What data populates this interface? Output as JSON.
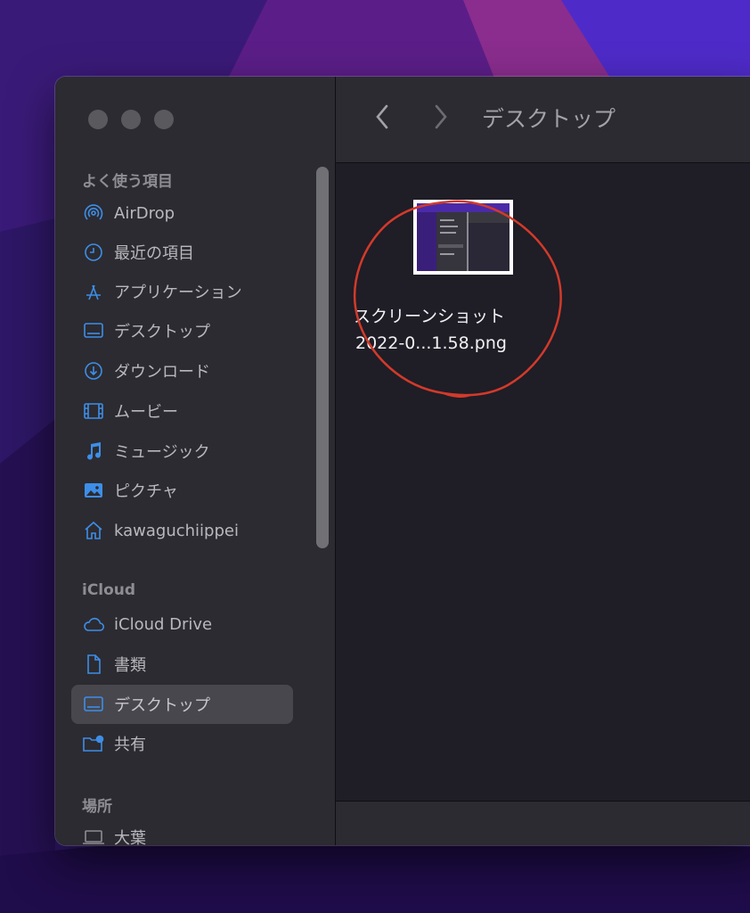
{
  "sidebar": {
    "favorites_title": "よく使う項目",
    "icloud_title": "iCloud",
    "locations_title": "場所",
    "favorites": [
      {
        "label": "AirDrop",
        "icon": "airdrop-icon"
      },
      {
        "label": "最近の項目",
        "icon": "clock-icon"
      },
      {
        "label": "アプリケーション",
        "icon": "applications-icon"
      },
      {
        "label": "デスクトップ",
        "icon": "desktop-icon"
      },
      {
        "label": "ダウンロード",
        "icon": "download-icon"
      },
      {
        "label": "ムービー",
        "icon": "film-icon"
      },
      {
        "label": "ミュージック",
        "icon": "music-note-icon"
      },
      {
        "label": "ピクチャ",
        "icon": "photo-icon"
      },
      {
        "label": "kawaguchiippei",
        "icon": "home-icon"
      }
    ],
    "icloud": [
      {
        "label": "iCloud Drive",
        "icon": "cloud-icon"
      },
      {
        "label": "書類",
        "icon": "document-icon"
      },
      {
        "label": "デスクトップ",
        "icon": "desktop-icon",
        "selected": true
      },
      {
        "label": "共有",
        "icon": "shared-folder-icon"
      }
    ],
    "locations": [
      {
        "label": "大葉",
        "icon": "laptop-icon"
      }
    ]
  },
  "toolbar": {
    "title": "デスクトップ",
    "back_icon": "chevron-left-icon",
    "forward_icon": "chevron-right-icon"
  },
  "files": [
    {
      "name_line1": "スクリーンショット",
      "name_line2": "2022-0...1.58.png",
      "selected": true
    }
  ],
  "colors": {
    "accent_icon": "#3d8ee8",
    "annotation": "#d23a2a"
  }
}
